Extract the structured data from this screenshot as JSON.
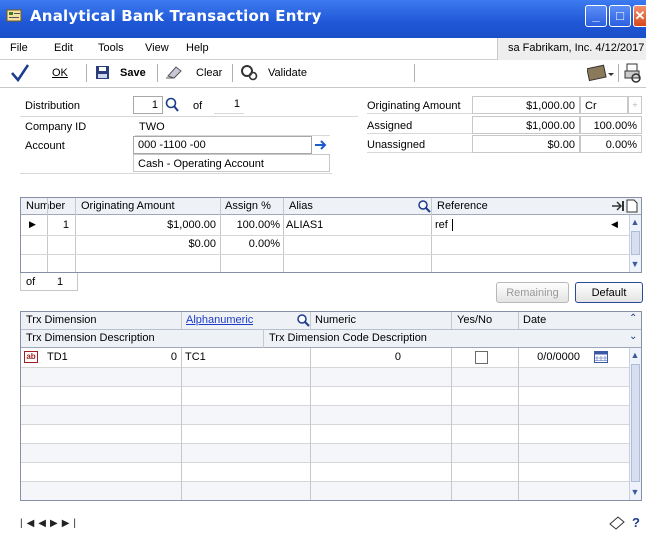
{
  "window": {
    "title": "Analytical Bank Transaction Entry"
  },
  "menu": {
    "items": [
      "File",
      "Edit",
      "Tools",
      "View",
      "Help"
    ],
    "company": "sa  Fabrikam, Inc.  4/12/2017"
  },
  "toolbar": {
    "ok_label": "OK",
    "save_label": "Save",
    "clear_label": "Clear",
    "validate_label": "Validate"
  },
  "header": {
    "distribution_label": "Distribution",
    "distribution_value": "1",
    "of_label": "of",
    "of_value": "1",
    "company_id_label": "Company ID",
    "company_id_value": "TWO",
    "account_label": "Account",
    "account_value": "000 -1100 -00",
    "account_description": "Cash - Operating Account",
    "originating_amount_label": "Originating Amount",
    "originating_amount_value": "$1,000.00",
    "originating_type": "Cr",
    "assigned_label": "Assigned",
    "assigned_value": "$1,000.00",
    "assigned_pct": "100.00%",
    "unassigned_label": "Unassigned",
    "unassigned_value": "$0.00",
    "unassigned_pct": "0.00%"
  },
  "assign_grid": {
    "columns": {
      "number": "Number",
      "originating_amount": "Originating Amount",
      "assign_pct": "Assign %",
      "alias": "Alias",
      "reference": "Reference"
    },
    "rows": [
      {
        "number": "1",
        "amount": "$1,000.00",
        "pct": "100.00%",
        "alias": "ALIAS1",
        "reference": "ref"
      },
      {
        "number": "",
        "amount": "$0.00",
        "pct": "0.00%",
        "alias": "",
        "reference": ""
      }
    ],
    "footer_of": "of",
    "footer_count": "1",
    "remaining_label": "Remaining",
    "default_label": "Default"
  },
  "dim_grid": {
    "columns": {
      "trx_dimension": "Trx Dimension",
      "alphanumeric": "Alphanumeric",
      "numeric": "Numeric",
      "yes_no": "Yes/No",
      "date": "Date"
    },
    "columns2": {
      "dim_desc": "Trx Dimension Description",
      "code_desc": "Trx Dimension Code Description"
    },
    "rows": [
      {
        "icon": "ab",
        "dimension": "TD1",
        "value": "0",
        "code": "TC1",
        "numeric": "0",
        "yes_no": false,
        "date": "0/0/0000"
      }
    ]
  },
  "navigation": {
    "first": "first-record",
    "prev": "previous-record",
    "next": "next-record",
    "last": "last-record"
  }
}
